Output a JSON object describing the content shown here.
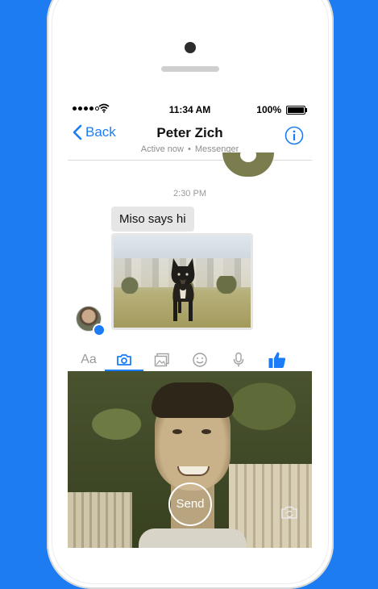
{
  "status_bar": {
    "time": "11:34 AM",
    "battery": "100%"
  },
  "nav": {
    "back_label": "Back",
    "title": "Peter Zich",
    "status": "Active now",
    "service": "Messenger",
    "separator": "•",
    "info_icon": "info-icon"
  },
  "chat": {
    "timestamp": "2:30 PM",
    "messages": [
      {
        "type": "text",
        "text": "Miso says hi"
      },
      {
        "type": "photo",
        "icon": "dog-photo"
      }
    ]
  },
  "composer": {
    "text_tool": "Aa",
    "tools": [
      "text-icon",
      "camera-icon",
      "gallery-icon",
      "sticker-icon",
      "microphone-icon",
      "like-icon"
    ],
    "active_tool": "camera-icon"
  },
  "camera": {
    "send_label": "Send",
    "flip_icon": "flip-camera-icon"
  },
  "colors": {
    "accent": "#1a7cf6",
    "background": "#1d7cf2",
    "bubble": "#e6e6e6"
  }
}
